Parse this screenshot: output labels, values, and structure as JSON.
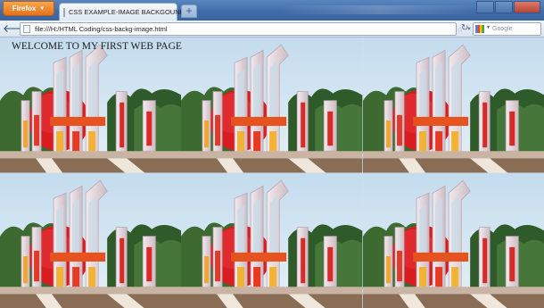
{
  "browser": {
    "menu_button_label": "Firefox",
    "tab_title": "CSS EXAMPLE-IMAGE BACKGOUND",
    "new_tab_label": "+",
    "url": "file:///H:/HTML Coding/css-backg-image.html",
    "search_placeholder": "Google"
  },
  "page": {
    "heading": "WELCOME TO MY FIRST WEB PAGE",
    "background_tiles": {
      "columns": 3,
      "rows": 2,
      "subject": "Shaheed Minar monument with red sun disc"
    }
  },
  "colors": {
    "sky": "#cfe3f1",
    "sun_disc": "#d81c20",
    "monument": "#e9dde2",
    "trees": "#2f5a2a",
    "ground": "#8a6d55"
  }
}
